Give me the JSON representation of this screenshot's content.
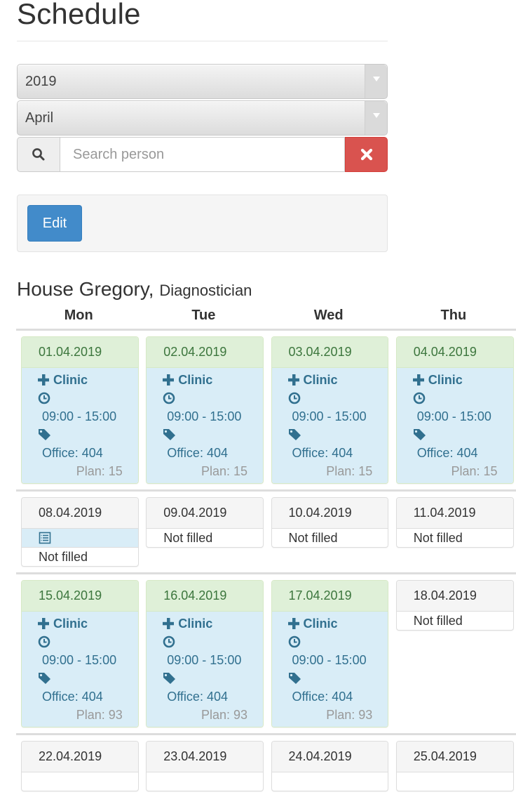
{
  "page": {
    "title": "Schedule"
  },
  "filters": {
    "year": "2019",
    "month": "April",
    "search_placeholder": "Search person",
    "search_value": ""
  },
  "toolbar": {
    "edit_label": "Edit"
  },
  "person": {
    "name": "House Gregory,",
    "role": "Diagnostician"
  },
  "weekdays": [
    "Mon",
    "Tue",
    "Wed",
    "Thu"
  ],
  "colors": {
    "danger": "#d9534f",
    "primary": "#428bca",
    "success_bg": "#dff0d8",
    "info_bg": "#d9edf7",
    "info_text": "#31708f"
  },
  "weeks": [
    {
      "days": [
        {
          "date": "01.04.2019",
          "status": "filled",
          "type": "Clinic",
          "time": "09:00 - 15:00",
          "office": "Office: 404",
          "plan": "Plan: 15"
        },
        {
          "date": "02.04.2019",
          "status": "filled",
          "type": "Clinic",
          "time": "09:00 - 15:00",
          "office": "Office: 404",
          "plan": "Plan: 15"
        },
        {
          "date": "03.04.2019",
          "status": "filled",
          "type": "Clinic",
          "time": "09:00 - 15:00",
          "office": "Office: 404",
          "plan": "Plan: 15"
        },
        {
          "date": "04.04.2019",
          "status": "filled",
          "type": "Clinic",
          "time": "09:00 - 15:00",
          "office": "Office: 404",
          "plan": "Plan: 15"
        }
      ]
    },
    {
      "days": [
        {
          "date": "08.04.2019",
          "status": "list",
          "text": "Not filled"
        },
        {
          "date": "09.04.2019",
          "status": "empty",
          "text": "Not filled"
        },
        {
          "date": "10.04.2019",
          "status": "empty",
          "text": "Not filled"
        },
        {
          "date": "11.04.2019",
          "status": "empty",
          "text": "Not filled"
        }
      ]
    },
    {
      "days": [
        {
          "date": "15.04.2019",
          "status": "filled",
          "type": "Clinic",
          "time": "09:00 - 15:00",
          "office": "Office: 404",
          "plan": "Plan: 93"
        },
        {
          "date": "16.04.2019",
          "status": "filled",
          "type": "Clinic",
          "time": "09:00 - 15:00",
          "office": "Office: 404",
          "plan": "Plan: 93"
        },
        {
          "date": "17.04.2019",
          "status": "filled",
          "type": "Clinic",
          "time": "09:00 - 15:00",
          "office": "Office: 404",
          "plan": "Plan: 93"
        },
        {
          "date": "18.04.2019",
          "status": "empty",
          "text": "Not filled"
        }
      ]
    },
    {
      "days": [
        {
          "date": "22.04.2019",
          "status": "partial"
        },
        {
          "date": "23.04.2019",
          "status": "partial"
        },
        {
          "date": "24.04.2019",
          "status": "partial"
        },
        {
          "date": "25.04.2019",
          "status": "partial"
        }
      ]
    }
  ]
}
